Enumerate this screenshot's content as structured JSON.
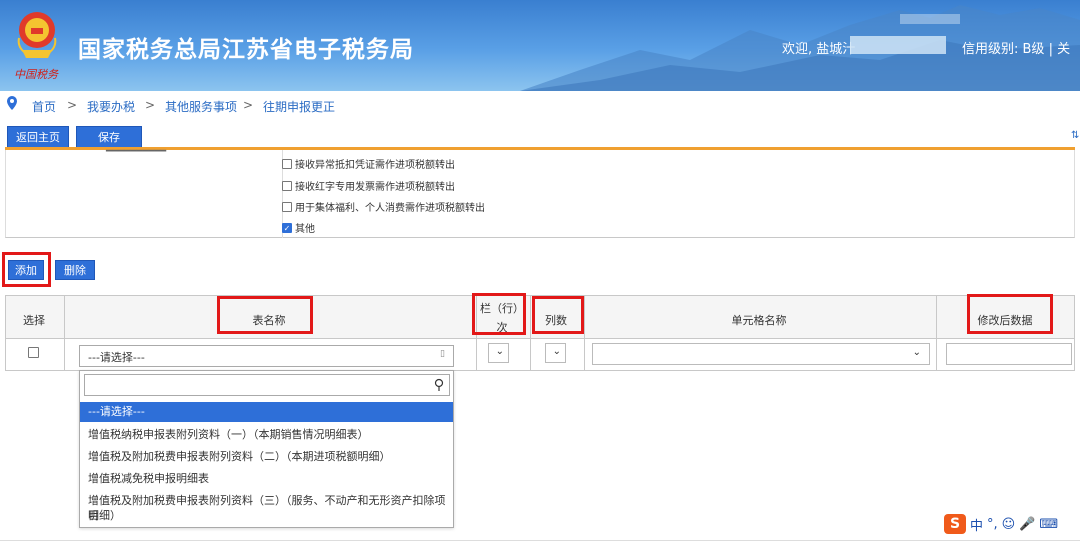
{
  "header": {
    "site_title": "国家税务总局江苏省电子税务局",
    "signature": "中国税务",
    "welcome": "欢迎, 盐城汁",
    "credit": "信用级别: B级 | 关"
  },
  "breadcrumb": [
    "首页",
    "我要办税",
    "其他服务事项",
    "往期申报更正"
  ],
  "toolbar": {
    "home": "返回主页",
    "save": "保存"
  },
  "checkboxes": [
    {
      "label": "接收异常抵扣凭证需作进项税额转出",
      "checked": false
    },
    {
      "label": "接收红字专用发票需作进项税额转出",
      "checked": false
    },
    {
      "label": "用于集体福利、个人消费需作进项税额转出",
      "checked": false
    },
    {
      "label": "其他",
      "checked": true
    }
  ],
  "actions": {
    "add": "添加",
    "delete": "删除"
  },
  "table": {
    "headers": {
      "select": "选择",
      "sheet_name": "表名称",
      "row_no_1": "栏（行）",
      "row_no_2": "次",
      "col_no": "列数",
      "cell_name": "单元格名称",
      "new_value": "修改后数据"
    },
    "row": {
      "sheet_placeholder": "---请选择---"
    }
  },
  "dropdown": {
    "options": [
      "---请选择---",
      "增值税纳税申报表附列资料（一）（本期销售情况明细表）",
      "增值税及附加税费申报表附列资料（二）（本期进项税额明细）",
      "增值税减免税申报明细表",
      "增值税及附加税费申报表附列资料（三）（服务、不动产和无形资产扣除项目",
      "明细）"
    ],
    "selected_index": 0
  },
  "ime": {
    "lang": "中",
    "punct": "°,"
  },
  "colors": {
    "accent": "#2e6fd8",
    "highlight": "#e21818",
    "header_top": "#3a7fd0"
  }
}
